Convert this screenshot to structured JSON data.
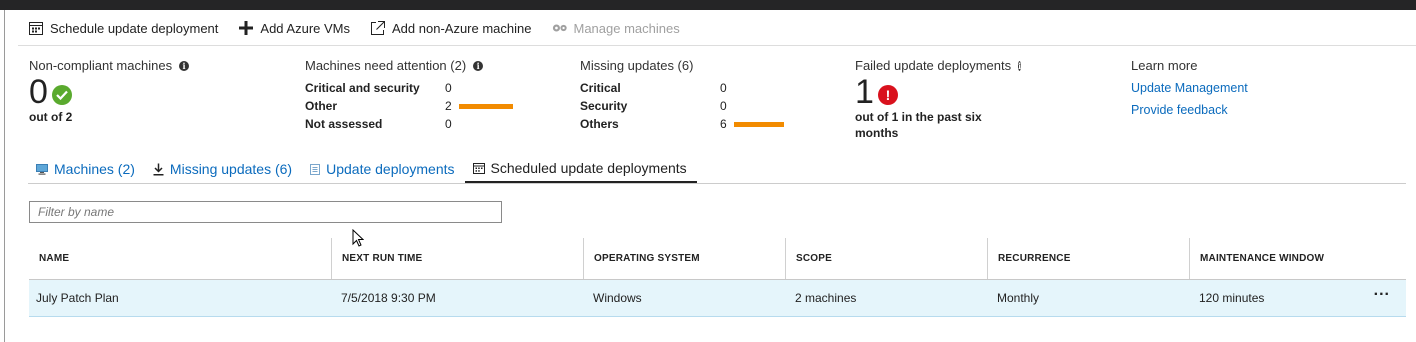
{
  "toolbar": {
    "schedule_update": "Schedule update deployment",
    "add_azure_vms": "Add Azure VMs",
    "add_non_azure": "Add non-Azure machine",
    "manage_machines": "Manage machines"
  },
  "summary": {
    "noncompliant": {
      "title": "Non-compliant machines",
      "value": "0",
      "sub": "out of 2"
    },
    "attention": {
      "title": "Machines need attention (2)",
      "rows": [
        {
          "label": "Critical and security",
          "value": "0",
          "bar_fraction": 0
        },
        {
          "label": "Other",
          "value": "2",
          "bar_fraction": 0.75
        },
        {
          "label": "Not assessed",
          "value": "0",
          "bar_fraction": 0
        }
      ]
    },
    "missing": {
      "title": "Missing updates (6)",
      "rows": [
        {
          "label": "Critical",
          "value": "0",
          "bar_fraction": 0
        },
        {
          "label": "Security",
          "value": "0",
          "bar_fraction": 0
        },
        {
          "label": "Others",
          "value": "6",
          "bar_fraction": 0.7
        }
      ]
    },
    "failed": {
      "title": "Failed update deployments",
      "value": "1",
      "sub": "out of 1 in the past six months"
    },
    "learn": {
      "title": "Learn more",
      "links": [
        "Update Management",
        "Provide feedback"
      ]
    }
  },
  "tabs": [
    {
      "label": "Machines (2)",
      "icon": "monitor-icon",
      "active": false
    },
    {
      "label": "Missing updates (6)",
      "icon": "download-icon",
      "active": false
    },
    {
      "label": "Update deployments",
      "icon": "list-icon",
      "active": false
    },
    {
      "label": "Scheduled update deployments",
      "icon": "calendar-icon",
      "active": true
    }
  ],
  "filter": {
    "placeholder": "Filter by name",
    "value": ""
  },
  "grid": {
    "columns": [
      "NAME",
      "NEXT RUN TIME",
      "OPERATING SYSTEM",
      "SCOPE",
      "RECURRENCE",
      "MAINTENANCE WINDOW"
    ],
    "rows": [
      [
        "July Patch Plan",
        "7/5/2018 9:30 PM",
        "Windows",
        "2 machines",
        "Monthly",
        "120 minutes"
      ]
    ],
    "row_menu": "..."
  },
  "colors": {
    "link": "#0b6bbd",
    "bar": "#f28b00",
    "ok": "#5aaa2e",
    "error": "#d9111d",
    "row_selected": "#e5f5fb"
  }
}
